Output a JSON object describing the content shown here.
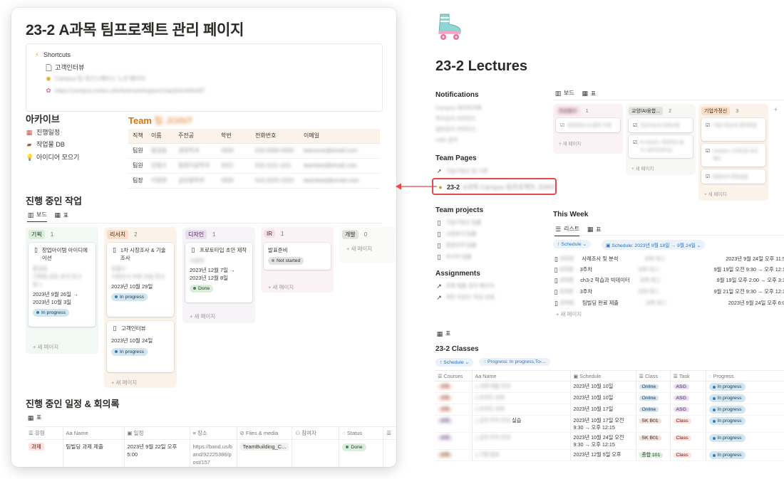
{
  "left": {
    "title_prefix": "23-2",
    "title_blurred": "A",
    "title_rest": "A과목 팀프로젝트 관리 페이지",
    "shortcuts": {
      "header": "Shortcuts",
      "item1": "고객인터뷰",
      "item2": "Campus 팀 워크스페이스 노션 페이지",
      "item3": "https://campus.notion.site/teamworkspace/1aa2b3c4d5e6f7"
    },
    "archive": {
      "title": "아카이브",
      "items": [
        "진행일정",
        "작업물 DB",
        "아이디어 모으기"
      ]
    },
    "team": {
      "title_prefix": "Team",
      "title_blurred": "팀 JOINT",
      "headers": [
        "직책",
        "이름",
        "주전공",
        "학번",
        "전화번호",
        "이메일"
      ],
      "rows": [
        [
          "팀원",
          "홍길동",
          "경영학과",
          "2020",
          "010-0000-0000",
          "teamone@email.com"
        ],
        [
          "팀원",
          "김철수",
          "컴퓨터공학과",
          "2021",
          "010-1111-1111",
          "teamtwo@email.com"
        ],
        [
          "팀장",
          "이영희",
          "글로벌학부",
          "2020",
          "010-2222-2222",
          "teamlead@email.com"
        ]
      ]
    },
    "work": {
      "title": "진행 중인 작업",
      "tabs": [
        "보드",
        "표"
      ],
      "columns": [
        {
          "tag": "기획",
          "count": "1"
        },
        {
          "tag": "리서치",
          "count": "2"
        },
        {
          "tag": "디자인",
          "count": "1"
        },
        {
          "tag": "IR",
          "count": "1"
        },
        {
          "tag": "개발",
          "count": "0"
        }
      ],
      "cards": {
        "c1_title": "창업아이템 아이디에이션",
        "c1_p1": "홍길동",
        "c1_p2": "기획팀 공유 문서 링크",
        "c1_p3": "팀 1",
        "c1_date": "2023년 9월 26일 → 2023년 10월 3일",
        "c1_status": "In progress",
        "c2_title": "1차 시장조사 & 기술조사",
        "c2_p1": "김철수",
        "c2_p2": "시장조사 자료 모음 링크",
        "c2_date": "2023년 10월 29일",
        "c2_status": "In progress",
        "c3_title": "고객인터뷰",
        "c3_date": "2023년 10월 24일",
        "c3_status": "In progress",
        "c4_title": "프로토타입 초안 제작",
        "c4_p1": "이영희",
        "c4_date": "2023년 12월 7일 → 2023년 12월 8일",
        "c4_status": "Done",
        "c5_title": "발표준비",
        "c5_status": "Not started"
      },
      "new_page": "+ 새 페이지"
    },
    "schedule": {
      "title": "진행 중인 일정 & 회의록",
      "tab": "표",
      "headers": [
        "유형",
        "Name",
        "일정",
        "장소",
        "Files & media",
        "참여자",
        "Status"
      ],
      "row": {
        "type": "과제",
        "name": "팀빌딩 과제 제출",
        "date": "2023년 9월 22일 오후 5:00",
        "place": "https://band.us/band/92225386/post/157",
        "file": "TeamBuilding_C...",
        "status": "Done"
      }
    }
  },
  "right": {
    "title": "23-2 Lectures",
    "notifications": {
      "title": "Notifications",
      "items": [
        "Campus 네이버카페",
        "학사공지 리마인드",
        "일반공지 리마인드",
        "LMS 공지"
      ]
    },
    "board": {
      "tabs": [
        "보드",
        "표"
      ],
      "columns": [
        {
          "tag": "전공필수",
          "count": "1",
          "cards": [
            "경영정보시스템의 이해"
          ]
        },
        {
          "tag": "교양/AI융합...",
          "count": "2",
          "cards": [
            "인공지능과 미래사회",
            "R-AIDSS, 빅데이터 분석, 데이터마이닝"
          ]
        },
        {
          "tag": "기업가정신",
          "count": "3",
          "cards": [
            "기업가정신과 벤처창업",
            "Campus 스타트업 프로젝트",
            "팀빌딩과 창업실습"
          ]
        }
      ],
      "new_page": "+ 새 페이지"
    },
    "team_pages": {
      "title": "Team Pages",
      "item1": "기업가정신 팀 기록",
      "item2_prefix": "23-2",
      "item2_blurred": "A과목 Campus 팀프로젝트 JOINT"
    },
    "team_projects": {
      "title": "Team projects",
      "items": [
        "기업가정신 팀플",
        "시장분석 팀플",
        "경영전략 팀플",
        "리서치 팀플"
      ]
    },
    "assignments": {
      "title": "Assignments",
      "items": [
        "과제 제출 관리 페이지",
        "개인 리포트 작성 과제"
      ]
    },
    "this_week": {
      "title": "This Week",
      "tabs": [
        "리스트",
        "표"
      ],
      "filter_schedule": "Schedule",
      "filter_date": "Schedule: 2023년 9월 18일 → 9월 24일",
      "rows": [
        {
          "name": "사례조사 및 분석",
          "date": "2023년 9월 24일 오후 11:59"
        },
        {
          "name": "3주차",
          "date": "9월 19일 오전 9:30 → 오후 12:15"
        },
        {
          "name": "ch3-2 학습과 빅데이터",
          "date": "9월 19일 오후 2:00 → 오후 3:15"
        },
        {
          "name": "3주차",
          "date": "9월 21일 오전 9:30 → 오후 12:15"
        },
        {
          "name": "팀빌딩 완료 제출",
          "date": "2023년 9월 24일 오후 6:00"
        }
      ],
      "new_page": "+ 새 페이지"
    },
    "classes": {
      "tab": "표",
      "title": "23-2 Classes",
      "filter_schedule": "Schedule",
      "filter_progress": "Progress: In progress,To-...",
      "headers": [
        "Courses",
        "Name",
        "Schedule",
        "Class",
        "Task",
        "Progress"
      ],
      "rows": [
        {
          "schedule": "2023년 10월 10일",
          "class": "Online",
          "task": "ASG",
          "progress": "In progress"
        },
        {
          "schedule": "2023년 10월 10일",
          "class": "Online",
          "task": "ASG",
          "progress": "In progress"
        },
        {
          "schedule": "2023년 10월 17일",
          "class": "Online",
          "task": "ASG",
          "progress": "In progress"
        },
        {
          "name_suffix": "실습",
          "schedule": "2023년 10월 17일 오전 9:30 → 오후 12:15",
          "class": "SK B01",
          "task": "Class",
          "progress": "In progress"
        },
        {
          "schedule": "2023년 10월 24일 오전 9:30 → 오후 12:15",
          "class": "SK B01",
          "task": "Class",
          "progress": "In progress"
        },
        {
          "schedule": "2023년 12월 5일 오후",
          "class": "종합 101",
          "task": "Class",
          "progress": "In progress"
        }
      ]
    }
  },
  "colors": {
    "accent_red": "#e5484d",
    "team_orange": "#d9730d",
    "link_blue": "#2f6fbf"
  }
}
